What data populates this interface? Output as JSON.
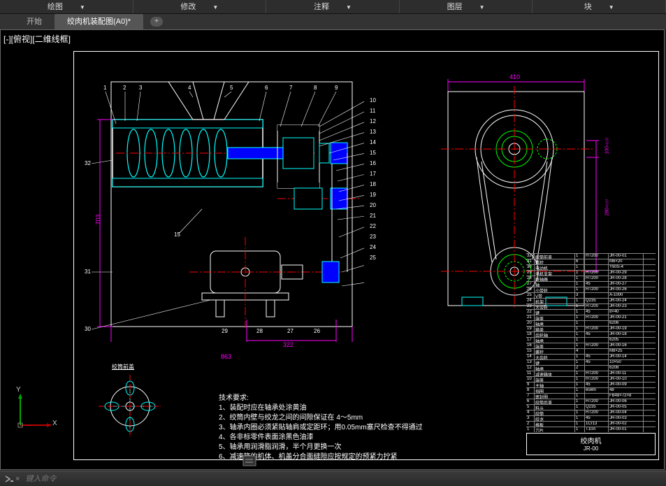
{
  "menubar": {
    "items": [
      "绘图",
      "修改",
      "注释",
      "图层",
      "块"
    ]
  },
  "tabs": {
    "start": "开始",
    "active": "绞肉机装配图(A0)*",
    "add": "+"
  },
  "viewlabel": "[-][俯视][二维线框]",
  "balloons_right": [
    "10",
    "11",
    "12",
    "13",
    "14",
    "15",
    "16",
    "17",
    "18",
    "19",
    "20",
    "21",
    "22",
    "23",
    "24",
    "25"
  ],
  "balloons_top": [
    "1",
    "2",
    "3",
    "4",
    "5",
    "6",
    "7",
    "8",
    "9"
  ],
  "balloons_left": [
    "32",
    "31",
    "30"
  ],
  "balloons_bot": [
    "29",
    "28",
    "27",
    "26"
  ],
  "balloon_inner": "15",
  "dims": {
    "d863": "863",
    "d322": "322",
    "d703": "703",
    "d410": "410",
    "d100": "100",
    "d280": "280",
    "tol1": "+0.07",
    "tol2": "-0.01",
    "tol3": "+0.07",
    "tol4": "-0.01"
  },
  "aux_label": "绞筒前盖",
  "notes": {
    "title": "技术要求:",
    "l1": "1、装配时应在轴承处涂黄油",
    "l2": "2、绞筒内壁与绞龙之间的间隙保证在 4～5mm",
    "l3": "3、轴承内圈必须紧贴轴肩或定距环；用0.05mm塞尺检查不得通过",
    "l4": "4、各非标零件表面涂黑色油漆",
    "l5": "5、轴承用润滑脂润滑，半个月更换一次",
    "l6": "6、减速箱的机体、机盖分合面缝隙应按规定的预紧力拧紧"
  },
  "bom_rows": [
    {
      "n": "32",
      "name": "绞筒前盖",
      "q": "1",
      "mat": "HT200",
      "code": "JR-00-01"
    },
    {
      "n": "31",
      "name": "螺栓",
      "q": "6",
      "mat": "",
      "code": "M6×20"
    },
    {
      "n": "30",
      "name": "电动机",
      "q": "1",
      "mat": "",
      "code": "Y90S-4"
    },
    {
      "n": "29",
      "name": "电机支架",
      "q": "1",
      "mat": "HT200",
      "code": "JR-00-29"
    },
    {
      "n": "28",
      "name": "联轴器",
      "q": "1",
      "mat": "HT200",
      "code": "JR-00-28"
    },
    {
      "n": "27",
      "name": "轴",
      "q": "1",
      "mat": "45",
      "code": "JR-00-27"
    },
    {
      "n": "26",
      "name": "小带轮",
      "q": "1",
      "mat": "HT200",
      "code": "JR-00-26"
    },
    {
      "n": "25",
      "name": "V带",
      "q": "3",
      "mat": "",
      "code": "A-1000"
    },
    {
      "n": "24",
      "name": "机架",
      "q": "1",
      "mat": "Q235",
      "code": "JR-00-24"
    },
    {
      "n": "23",
      "name": "大带轮",
      "q": "1",
      "mat": "HT200",
      "code": "JR-00-23"
    },
    {
      "n": "22",
      "name": "键",
      "q": "1",
      "mat": "45",
      "code": "8×40"
    },
    {
      "n": "21",
      "name": "端盖",
      "q": "1",
      "mat": "HT200",
      "code": "JR-00-21"
    },
    {
      "n": "20",
      "name": "轴承",
      "q": "1",
      "mat": "",
      "code": "6206"
    },
    {
      "n": "19",
      "name": "箱盖",
      "q": "1",
      "mat": "HT200",
      "code": "JR-00-19"
    },
    {
      "n": "18",
      "name": "齿轮轴",
      "q": "1",
      "mat": "45",
      "code": "JR-00-18"
    },
    {
      "n": "17",
      "name": "轴承",
      "q": "1",
      "mat": "",
      "code": "6205"
    },
    {
      "n": "16",
      "name": "端盖",
      "q": "1",
      "mat": "HT200",
      "code": "JR-00-16"
    },
    {
      "n": "15",
      "name": "螺栓",
      "q": "4",
      "mat": "",
      "code": "M8×25"
    },
    {
      "n": "14",
      "name": "大齿轮",
      "q": "1",
      "mat": "45",
      "code": "JR-00-14"
    },
    {
      "n": "13",
      "name": "键",
      "q": "1",
      "mat": "45",
      "code": "10×50"
    },
    {
      "n": "12",
      "name": "轴承",
      "q": "2",
      "mat": "",
      "code": "6208"
    },
    {
      "n": "11",
      "name": "减速箱体",
      "q": "1",
      "mat": "HT200",
      "code": "JR-00-11"
    },
    {
      "n": "10",
      "name": "端盖",
      "q": "1",
      "mat": "HT200",
      "code": "JR-00-10"
    },
    {
      "n": "9",
      "name": "主轴",
      "q": "1",
      "mat": "45",
      "code": "JR-00-09"
    },
    {
      "n": "8",
      "name": "挡圈",
      "q": "1",
      "mat": "65Mn",
      "code": "48"
    },
    {
      "n": "7",
      "name": "密封圈",
      "q": "1",
      "mat": "",
      "code": "FB48×72×8"
    },
    {
      "n": "6",
      "name": "绞筒后盖",
      "q": "1",
      "mat": "HT200",
      "code": "JR-00-06"
    },
    {
      "n": "5",
      "name": "料斗",
      "q": "1",
      "mat": "Q235",
      "code": "JR-00-05"
    },
    {
      "n": "4",
      "name": "绞筒",
      "q": "1",
      "mat": "HT200",
      "code": "JR-00-04"
    },
    {
      "n": "3",
      "name": "绞龙",
      "q": "1",
      "mat": "45",
      "code": "JR-00-03"
    },
    {
      "n": "2",
      "name": "格板",
      "q": "1",
      "mat": "1Cr13",
      "code": "JR-00-02"
    },
    {
      "n": "1",
      "name": "刀片",
      "q": "1",
      "mat": "T10A",
      "code": "JR-00-01"
    }
  ],
  "titleblock": {
    "name": "绞肉机",
    "dwgno": "JR-00"
  },
  "cmd": {
    "placeholder": "键入命令",
    "prompt": "×"
  },
  "ucs": {
    "x": "X",
    "y": "Y"
  }
}
